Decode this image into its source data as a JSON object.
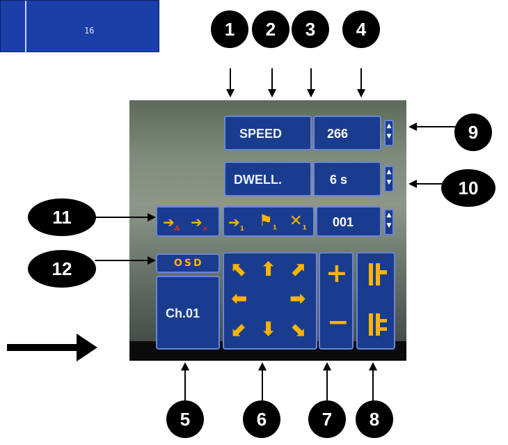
{
  "thumbnail": {
    "value": "16"
  },
  "menu": {
    "speed_label": "SPEED",
    "speed_value": "266",
    "dwell_label": "DWELL.",
    "dwell_value": "6 s",
    "preset_value": "001",
    "osd_label": "OSD",
    "channel_label": "Ch.01",
    "plus": "+",
    "minus": "−"
  },
  "callouts": [
    "1",
    "2",
    "3",
    "4",
    "5",
    "6",
    "7",
    "8",
    "9",
    "10",
    "11",
    "12"
  ],
  "colors": {
    "panel": "#1a3c8e",
    "panel_border": "#6a86d8",
    "icon": "#ffb400",
    "callout": "#000000"
  },
  "icons": {
    "preset_a": "arrow-a-icon",
    "preset_clear": "arrow-x-icon",
    "goto_preset": "arrow-1-icon",
    "flag": "flag-icon",
    "clear_preset": "x-1-icon",
    "zoom_in": "zoom-tele-icon",
    "zoom_out": "zoom-wide-icon"
  }
}
